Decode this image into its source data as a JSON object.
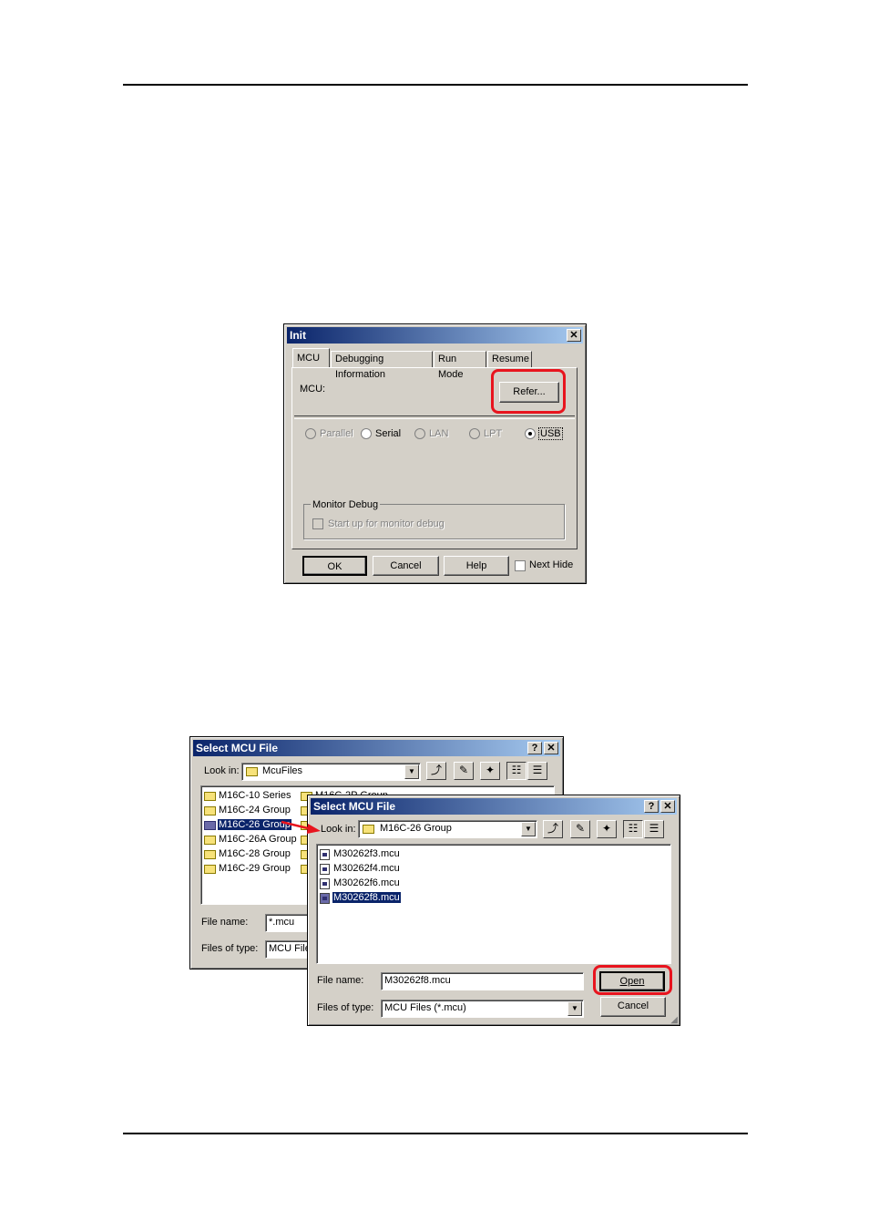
{
  "init_dialog": {
    "title": "Init",
    "tabs": [
      "MCU",
      "Debugging Information",
      "Run Mode",
      "Resume"
    ],
    "mcu_label": "MCU:",
    "refer_button": "Refer...",
    "connections": [
      "Parallel",
      "Serial",
      "LAN",
      "LPT",
      "USB"
    ],
    "selected_connection": "USB",
    "monitor_debug_group": "Monitor Debug",
    "monitor_checkbox": "Start up for monitor debug",
    "ok_button": "OK",
    "cancel_button": "Cancel",
    "help_button": "Help",
    "next_hide": "Next Hide"
  },
  "back_dialog": {
    "title": "Select MCU File",
    "look_in_label": "Look in:",
    "look_in_value": "McuFiles",
    "folders": [
      "M16C-10 Series",
      "M16C-24 Group",
      "M16C-26 Group",
      "M16C-26A Group",
      "M16C-28 Group",
      "M16C-29 Group"
    ],
    "folders_col2": [
      "M16C-2P Group"
    ],
    "file_name_label": "File name:",
    "file_name_value": "*.mcu",
    "files_of_type_label": "Files of type:",
    "files_of_type_value": "MCU File"
  },
  "front_dialog": {
    "title": "Select MCU File",
    "look_in_label": "Look in:",
    "look_in_value": "M16C-26 Group",
    "files": [
      "M30262f3.mcu",
      "M30262f4.mcu",
      "M30262f6.mcu",
      "M30262f8.mcu"
    ],
    "file_name_label": "File name:",
    "file_name_value": "M30262f8.mcu",
    "files_of_type_label": "Files of type:",
    "files_of_type_value": "MCU Files (*.mcu)",
    "open_button": "Open",
    "cancel_button": "Cancel"
  },
  "colors": {
    "highlight": "#e8141e",
    "selection": "#0a246a",
    "titlebar": "#0a246a"
  }
}
